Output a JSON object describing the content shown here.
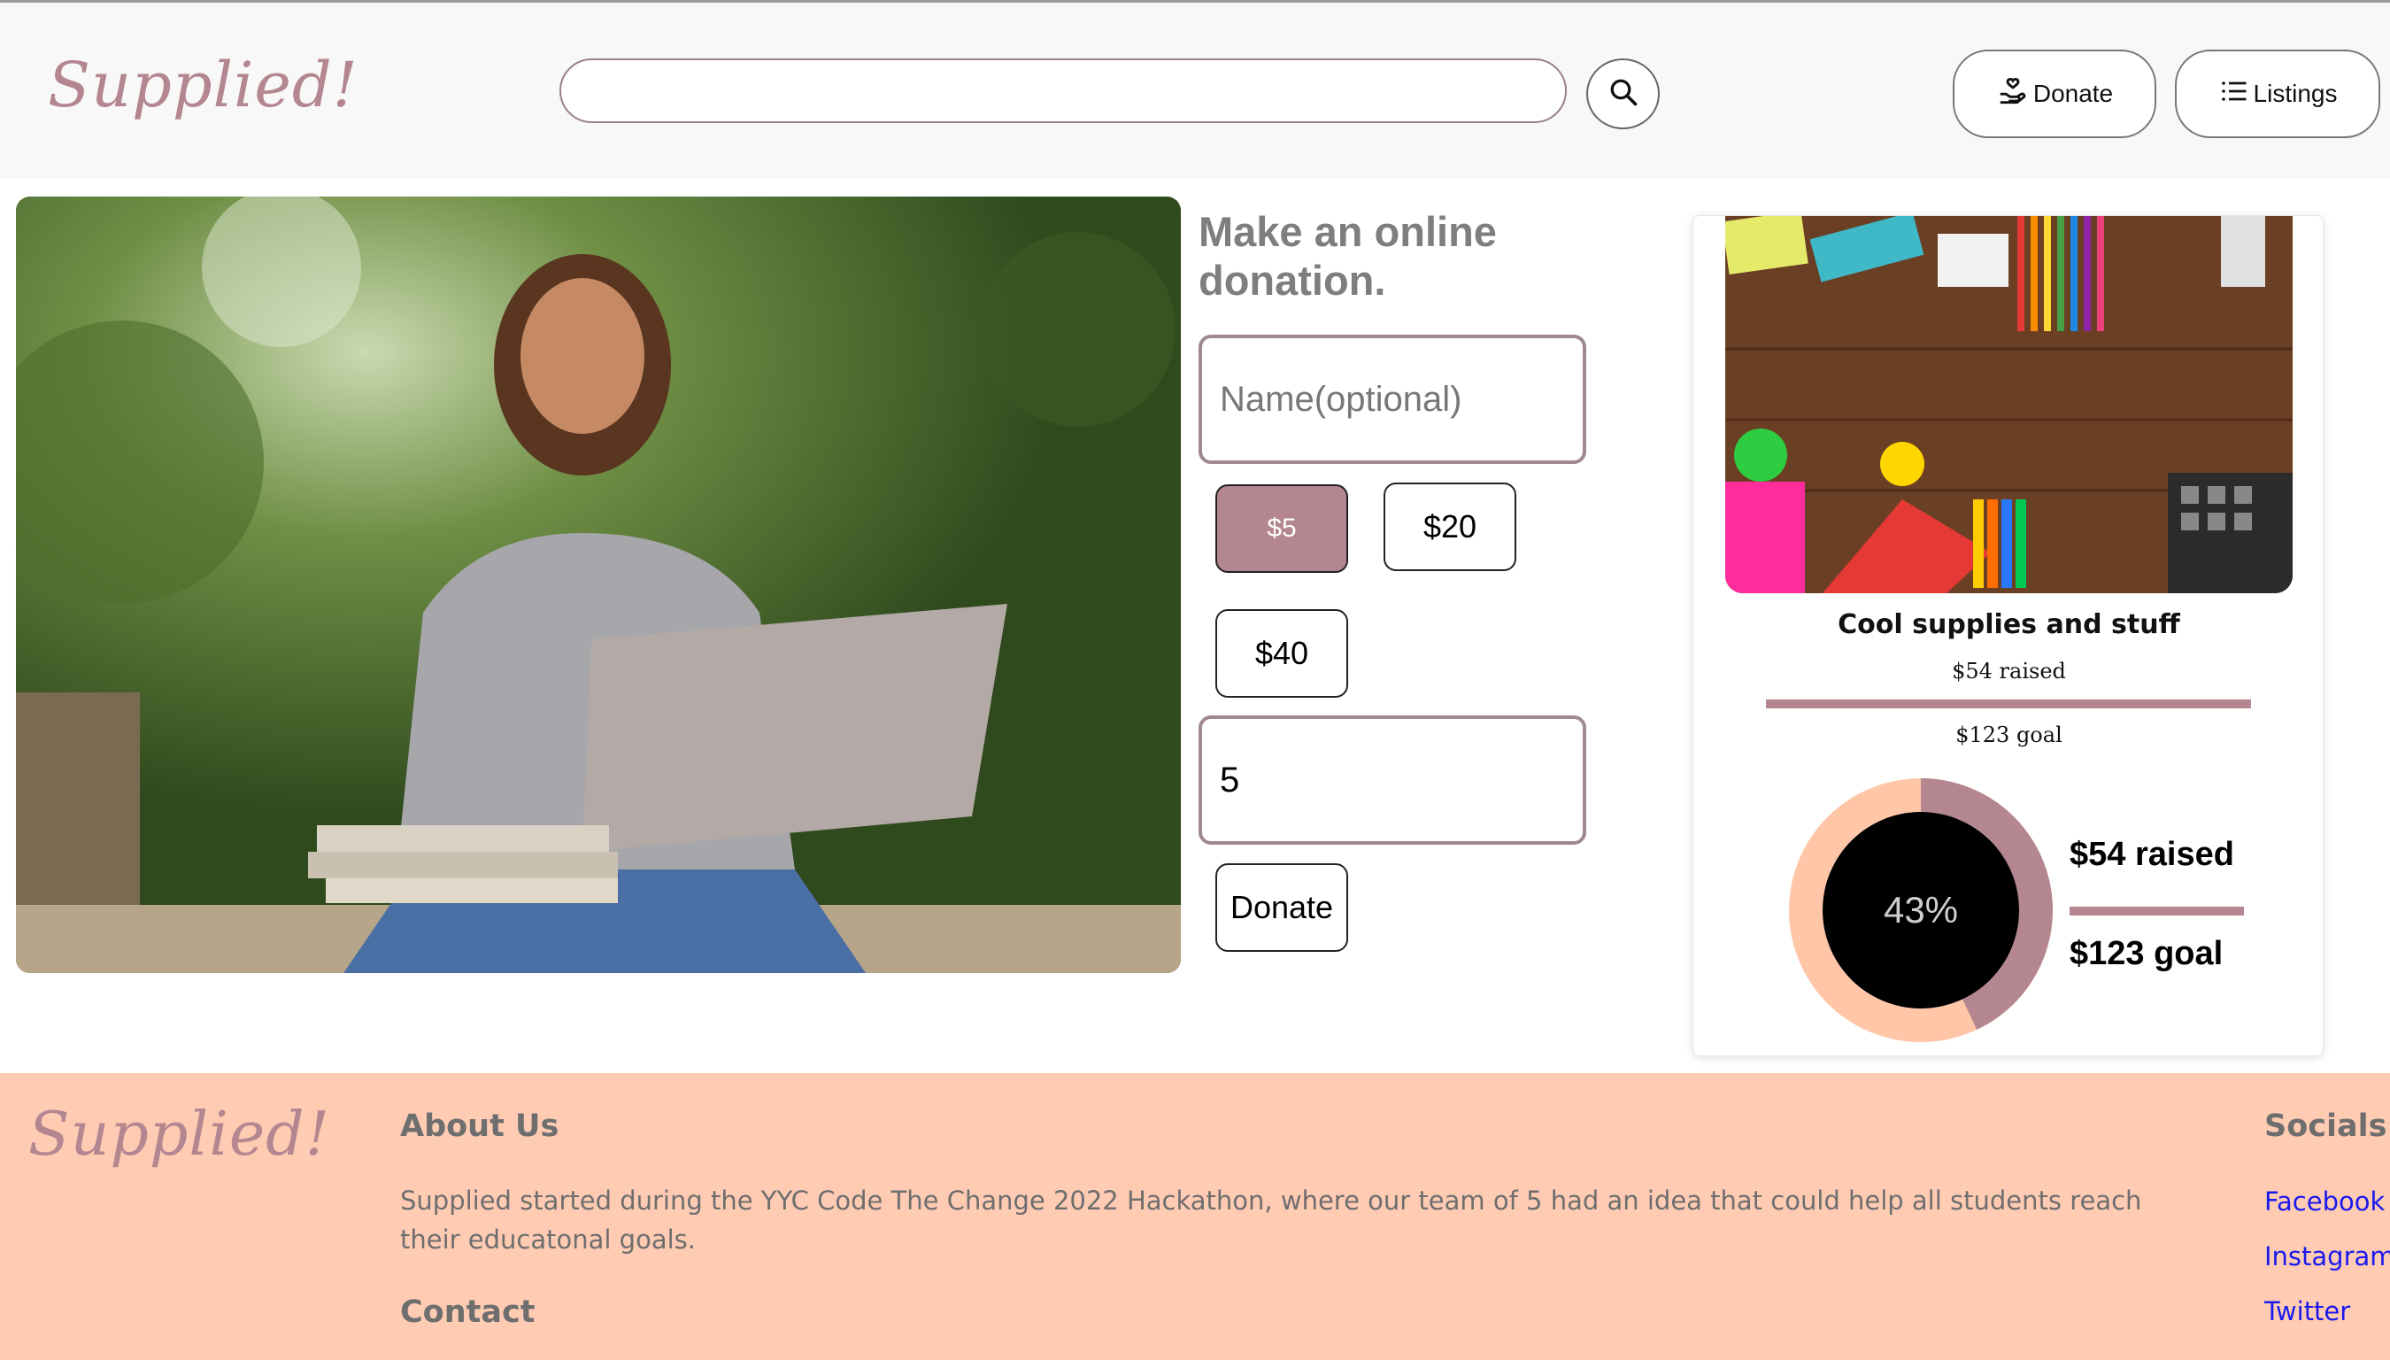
{
  "header": {
    "logo": "Supplied!",
    "search": {
      "value": "",
      "placeholder": ""
    },
    "nav": {
      "donate_label": "Donate",
      "listings_label": "Listings"
    }
  },
  "icons": {
    "search": "search-icon",
    "donate": "hand-heart-icon",
    "listings": "list-icon"
  },
  "hero": {
    "image": "smiling student with laptop outdoors"
  },
  "donation_form": {
    "title": "Make an online donation.",
    "name_placeholder": "Name(optional)",
    "preset_amounts": [
      "$5",
      "$20",
      "$40"
    ],
    "selected_amount": "$5",
    "amount_value": "5",
    "submit_label": "Donate"
  },
  "campaign": {
    "title": "Cool supplies and stuff",
    "raised_text": "$54 raised",
    "goal_text": "$123 goal",
    "progress_fraction": 0.43,
    "percent_label": "43%",
    "stat_raised": "$54 raised",
    "stat_goal": "$123 goal"
  },
  "footer": {
    "logo": "Supplied!",
    "about_heading": "About Us",
    "about_text": "Supplied started during the YYC Code The Change 2022 Hackathon, where our team of 5 had an idea that could help all students reach their educatonal goals.",
    "contact_heading": "Contact",
    "socials_heading": "Socials",
    "socials": [
      "Facebook",
      "Instagram",
      "Twitter"
    ]
  },
  "colors": {
    "accent": "#b48690",
    "footer_bg": "#ffcbb3",
    "donut_ring": "#ffc6a8",
    "donut_center": "#000000",
    "link": "#1a1aee"
  }
}
